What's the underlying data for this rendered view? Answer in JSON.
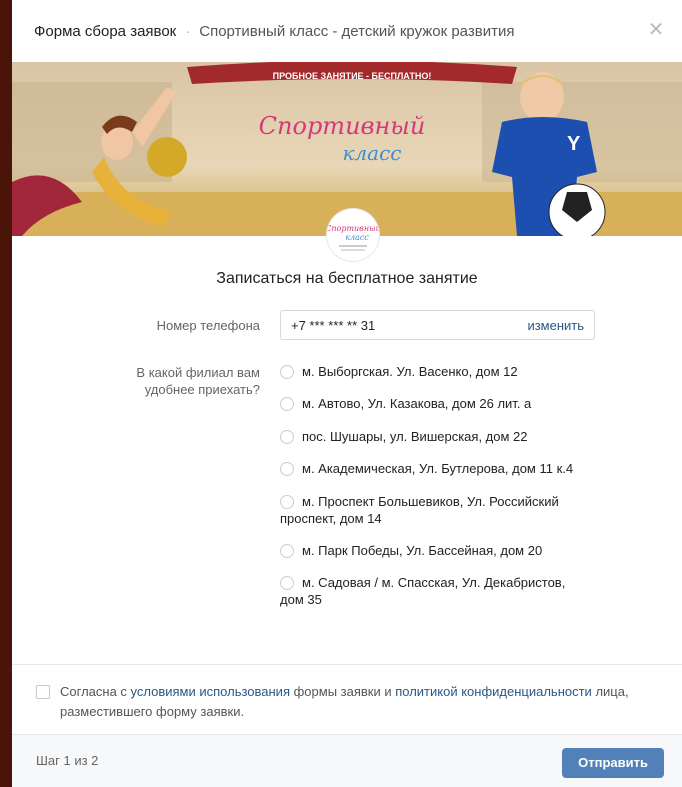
{
  "header": {
    "title": "Форма сбора заявок",
    "separator": "·",
    "subtitle": "Спортивный класс - детский кружок развития",
    "close_glyph": "✕"
  },
  "banner": {
    "ribbon_text": "ПРОБНОЕ ЗАНЯТИЕ - БЕСПЛАТНО!",
    "logo_line1": "Спортивный",
    "logo_line2": "класс"
  },
  "form": {
    "title": "Записаться на бесплатное занятие",
    "phone_label": "Номер телефона",
    "phone_value": "+7 *** *** ** 31",
    "phone_change": "изменить",
    "branch_label_line1": "В какой филиал вам",
    "branch_label_line2": "удобнее приехать?",
    "branches": [
      "м. Выборгская. Ул. Васенко, дом 12",
      "м. Автово, Ул. Казакова, дом 26 лит. а",
      "пос. Шушары, ул. Вишерская, дом 22",
      "м. Академическая, Ул. Бутлерова, дом 11 к.4",
      "м. Проспект Большевиков, Ул. Российский проспект, дом 14",
      "м. Парк Победы, Ул. Бассейная, дом 20",
      "м. Садовая / м. Спасская, Ул. Декабристов, дом 35"
    ]
  },
  "consent": {
    "part1": "Согласна с ",
    "link1": "условиями использования",
    "part2": " формы заявки и ",
    "link2": "политикой конфиденциальности",
    "part3": " лица, разместившего форму заявки."
  },
  "footer": {
    "step": "Шаг 1 из 2",
    "submit": "Отправить"
  },
  "colors": {
    "accent": "#5181b8",
    "link": "#2a5885",
    "ribbon": "#a32a2a"
  }
}
